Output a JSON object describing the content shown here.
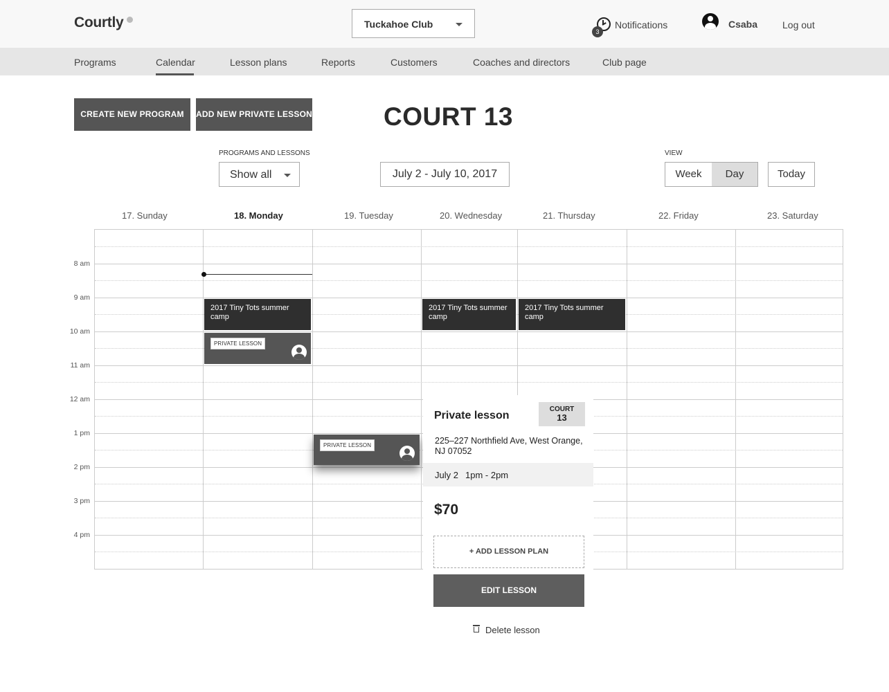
{
  "header": {
    "logo": "Courtly",
    "club_select": "Tuckahoe Club",
    "notifications": {
      "count": "3",
      "label": "Notifications"
    },
    "user_name": "Csaba",
    "logout": "Log out"
  },
  "nav": {
    "items": [
      "Programs",
      "Calendar",
      "Lesson plans",
      "Reports",
      "Customers",
      "Coaches and directors",
      "Club page"
    ],
    "active": "Calendar"
  },
  "actions": {
    "create_program": "CREATE NEW PROGRAM",
    "add_private_lesson": "ADD NEW PRIVATE LESSON"
  },
  "page_title": "COURT 13",
  "filters": {
    "programs_label": "PROGRAMS AND LESSONS",
    "programs_value": "Show all",
    "date_range": "July 2 - July 10, 2017",
    "view_label": "VIEW",
    "view_week": "Week",
    "view_day": "Day",
    "view_selected": "Day",
    "today": "Today"
  },
  "calendar": {
    "days": [
      "17. Sunday",
      "18. Monday",
      "19. Tuesday",
      "20. Wednesday",
      "21. Thursday",
      "22. Friday",
      "23. Saturday"
    ],
    "highlighted_day": "18. Monday",
    "times": [
      "8 am",
      "9 am",
      "10 am",
      "11 am",
      "12 am",
      "1 pm",
      "2 pm",
      "3 pm",
      "4 pm"
    ],
    "events": {
      "camp": "2017 Tiny Tots summer camp",
      "private_tag": "PRIVATE LESSON"
    }
  },
  "popover": {
    "title": "Private lesson",
    "court_label": "COURT",
    "court_number": "13",
    "address": "225–227 Northfield Ave, West Orange, NJ  07052",
    "date": "July 2",
    "time": "1pm - 2pm",
    "price": "$70",
    "add_plan": "+ ADD LESSON PLAN",
    "edit": "EDIT LESSON",
    "delete": "Delete lesson"
  },
  "colors": {
    "event_dark": "#2f2f2f",
    "event_private": "#555555",
    "button_dark": "#555555",
    "nav_bg": "#e6e6e6"
  }
}
